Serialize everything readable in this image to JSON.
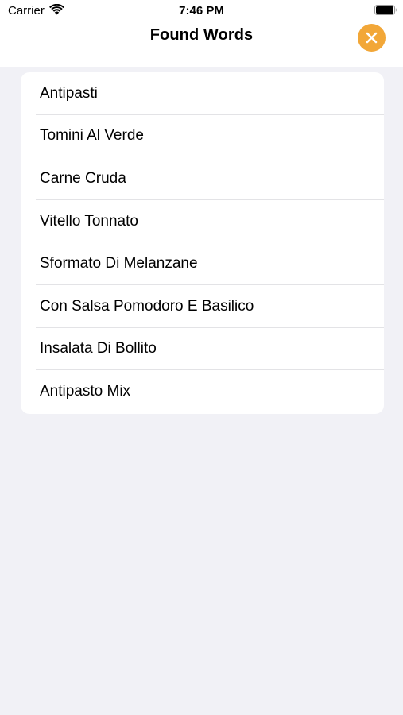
{
  "status_bar": {
    "carrier": "Carrier",
    "time": "7:46 PM",
    "wifi_icon": "wifi-icon",
    "battery_icon": "battery-full-icon"
  },
  "nav": {
    "title": "Found Words",
    "close_icon": "close-icon",
    "accent_color": "#f2a738"
  },
  "words": [
    "Antipasti",
    "Tomini Al Verde",
    "Carne Cruda",
    "Vitello Tonnato",
    "Sformato Di Melanzane",
    "Con Salsa Pomodoro E Basilico",
    "Insalata Di Bollito",
    "Antipasto Mix"
  ]
}
